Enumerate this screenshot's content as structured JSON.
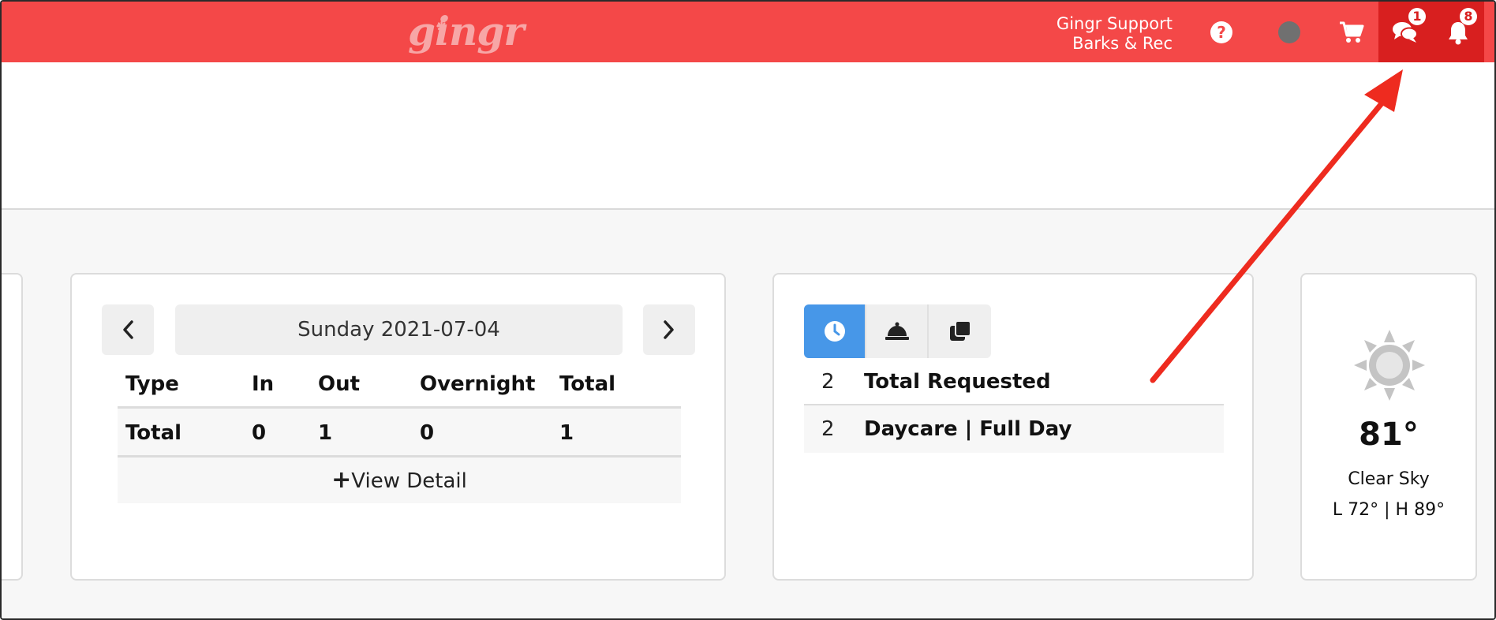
{
  "topbar": {
    "logo_text": "gingr",
    "user_name": "Gingr Support",
    "location": "Barks & Rec",
    "chat_badge": "1",
    "notification_badge": "8",
    "colors": {
      "bar": "#f44848",
      "active": "#d81f1f"
    }
  },
  "reservations": {
    "date": "Sunday 2021-07-04",
    "columns": [
      "Type",
      "In",
      "Out",
      "Overnight",
      "Total"
    ],
    "rows": [
      {
        "type": "Total",
        "in": "0",
        "out": "1",
        "overnight": "0",
        "total": "1"
      }
    ],
    "view_detail_label": "View Detail"
  },
  "requests": {
    "rows": [
      {
        "count": "2",
        "label": "Total Requested"
      },
      {
        "count": "2",
        "label": "Daycare | Full Day"
      }
    ],
    "tab_icons": [
      "clock-icon",
      "bell-service-icon",
      "copy-icon"
    ],
    "active_color": "#4797e8"
  },
  "weather": {
    "temperature": "81°",
    "condition": "Clear Sky",
    "low_high": "L 72° | H 89°"
  },
  "annotation": {
    "color": "#ee2b1f"
  }
}
